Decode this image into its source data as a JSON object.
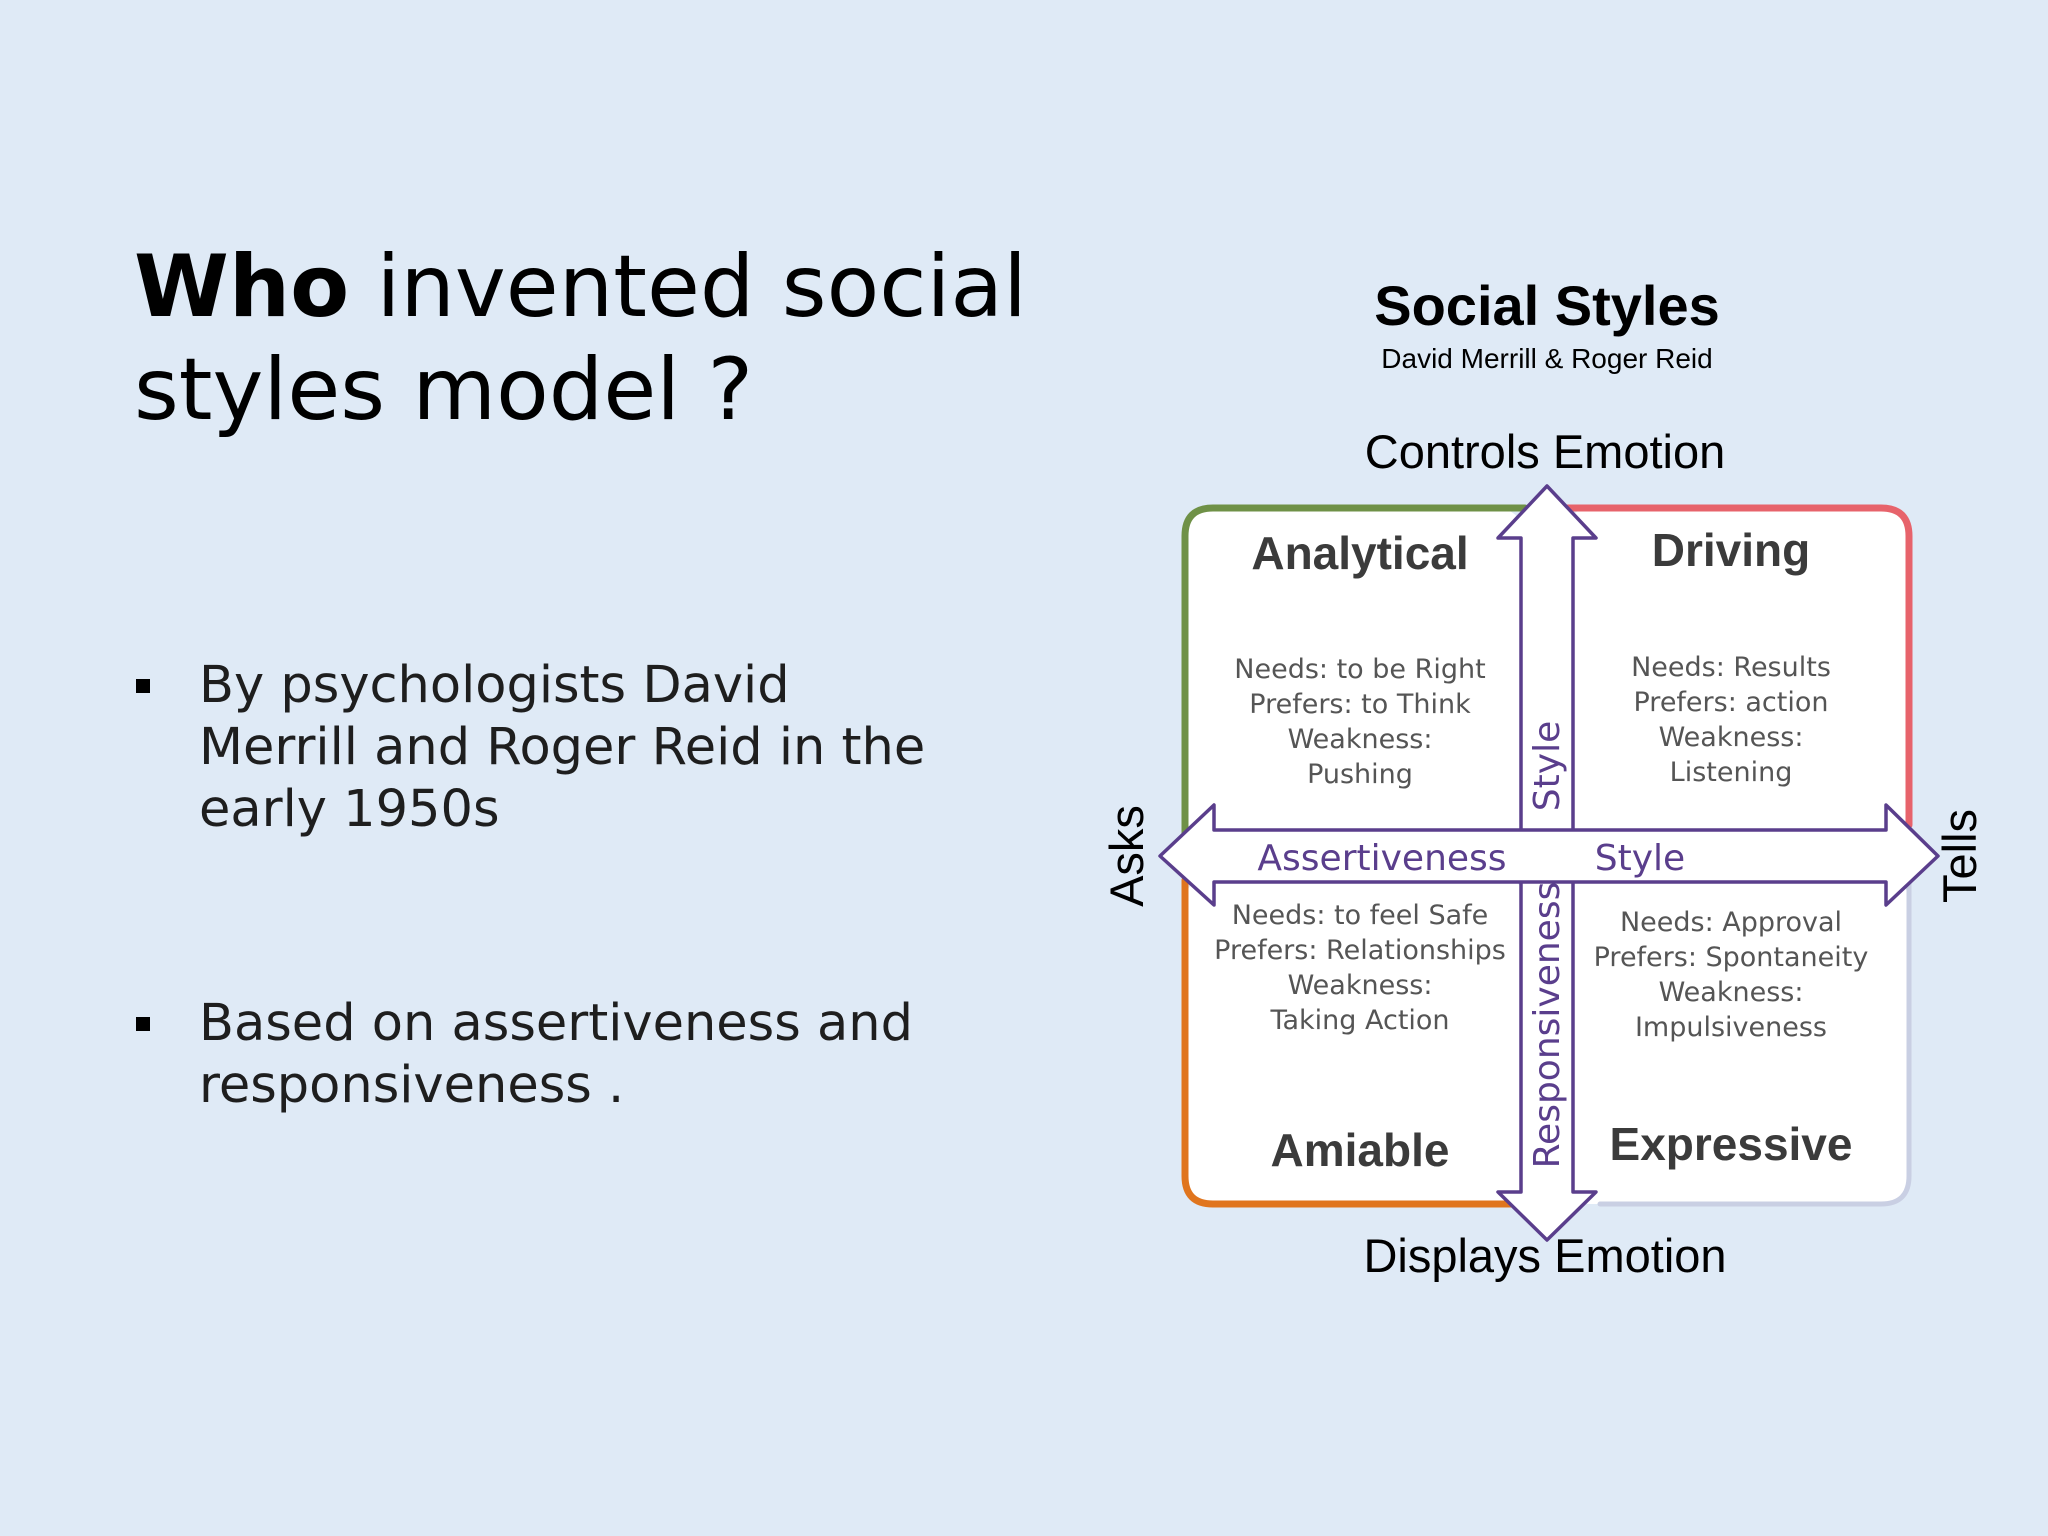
{
  "slide": {
    "title_bold": "Who",
    "title_rest": " invented social styles model ?",
    "bullets": [
      "By psychologists David Merrill and Roger Reid in the early 1950s",
      "Based on assertiveness and responsiveness ."
    ]
  },
  "diagram": {
    "title": "Social Styles",
    "subtitle": "David Merrill & Roger Reid",
    "axis_top": "Controls Emotion",
    "axis_bottom": "Displays Emotion",
    "axis_left": "Asks",
    "axis_right": "Tells",
    "horizontal_arrow_left": "Assertiveness",
    "horizontal_arrow_right": "Style",
    "vertical_arrow_top": "Style",
    "vertical_arrow_bottom": "Responsiveness",
    "colors": {
      "analytical": "#6f9147",
      "driving": "#e7636b",
      "amiable": "#e0751e",
      "expressive": "#c9cfe3",
      "arrow_stroke": "#5a3e8c",
      "arrow_text": "#5a3e8c"
    },
    "quadrants": {
      "analytical": {
        "name": "Analytical",
        "lines": [
          "Needs: to be Right",
          "Prefers: to Think",
          "Weakness:",
          "Pushing"
        ]
      },
      "driving": {
        "name": "Driving",
        "lines": [
          "Needs: Results",
          "Prefers: action",
          "Weakness:",
          "Listening"
        ]
      },
      "amiable": {
        "name": "Amiable",
        "lines": [
          "Needs: to feel Safe",
          "Prefers: Relationships",
          "Weakness:",
          "Taking Action"
        ]
      },
      "expressive": {
        "name": "Expressive",
        "lines": [
          "Needs: Approval",
          "Prefers: Spontaneity",
          "Weakness:",
          "Impulsiveness"
        ]
      }
    }
  }
}
